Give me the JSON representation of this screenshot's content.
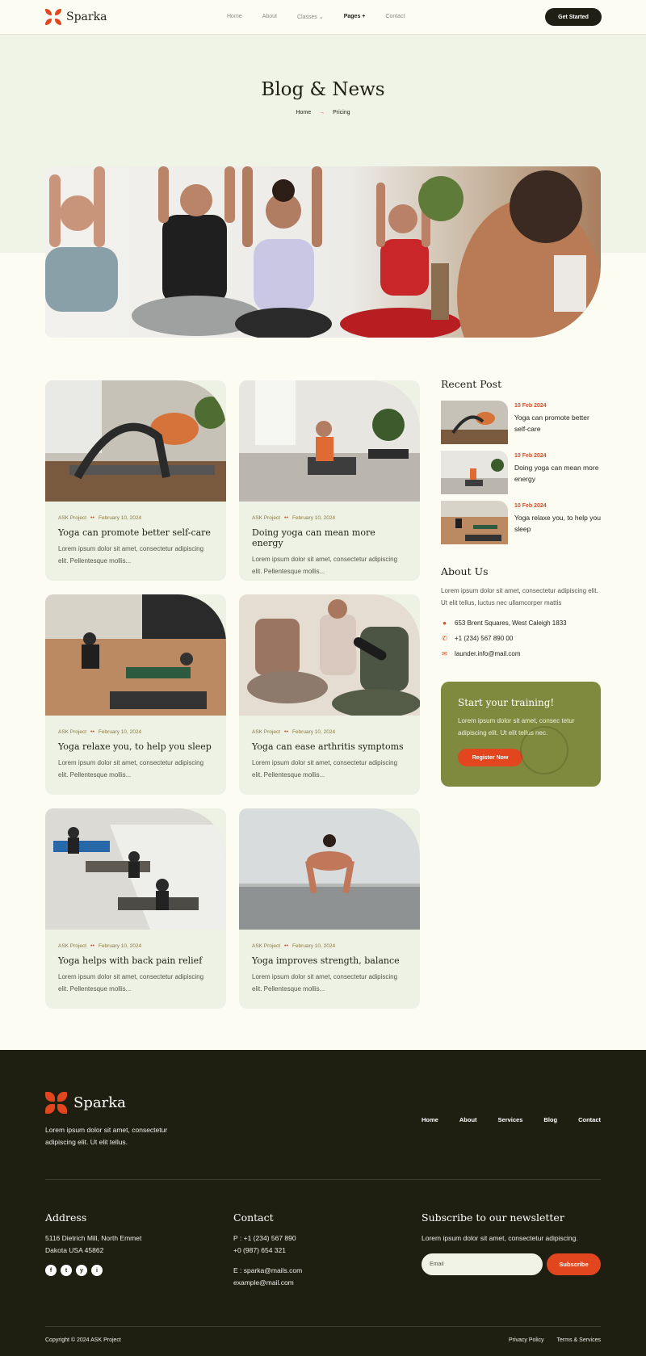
{
  "brand": {
    "name": "Sparka",
    "accent": "#e1461e",
    "dark": "#1f1f11",
    "olive": "#7f8a3f"
  },
  "nav": {
    "items": [
      "Home",
      "About",
      "Classes",
      "Pages",
      "Contact"
    ],
    "cta": "Get Started"
  },
  "hero": {
    "title": "Blog & News",
    "crumb_home": "Home",
    "crumb_current": "Pricing"
  },
  "posts": [
    {
      "category": "ASK Project",
      "date": "February 10, 2024",
      "title": "Yoga can promote better self-care",
      "excerpt": "Lorem ipsum dolor sit amet, consectetur adipiscing elit. Pellentesque mollis..."
    },
    {
      "category": "ASK Project",
      "date": "February 10, 2024",
      "title": "Doing yoga can mean more energy",
      "excerpt": "Lorem ipsum dolor sit amet, consectetur adipiscing elit. Pellentesque mollis..."
    },
    {
      "category": "ASK Project",
      "date": "February 10, 2024",
      "title": "Yoga relaxe you, to help you sleep",
      "excerpt": "Lorem ipsum dolor sit amet, consectetur adipiscing elit. Pellentesque mollis..."
    },
    {
      "category": "ASK Project",
      "date": "February 10, 2024",
      "title": "Yoga can ease arthritis symptoms",
      "excerpt": "Lorem ipsum dolor sit amet, consectetur adipiscing elit. Pellentesque mollis..."
    },
    {
      "category": "ASK Project",
      "date": "February 10, 2024",
      "title": "Yoga helps with back pain relief",
      "excerpt": "Lorem ipsum dolor sit amet, consectetur adipiscing elit. Pellentesque mollis..."
    },
    {
      "category": "ASK Project",
      "date": "February 10, 2024",
      "title": "Yoga improves strength, balance",
      "excerpt": "Lorem ipsum dolor sit amet, consectetur adipiscing elit. Pellentesque mollis..."
    }
  ],
  "sidebar": {
    "recent_title": "Recent Post",
    "recent": [
      {
        "date": "10 Feb 2024",
        "title": "Yoga can promote better self-care"
      },
      {
        "date": "10 Feb 2024",
        "title": "Doing yoga can mean more energy"
      },
      {
        "date": "10 Feb 2024",
        "title": "Yoga relaxe you, to help you sleep"
      }
    ],
    "about_title": "About Us",
    "about_text": "Lorem ipsum dolor sit amet, consectetur adipiscing elit. Ut elit tellus, luctus nec ullamcorper mattis",
    "address": "653 Brent Squares, West Caleigh 1833",
    "phone": "+1 (234) 567 890 00",
    "email": "launder.info@mail.com",
    "promo_title": "Start your training!",
    "promo_text": "Lorem ipsum dolor sit amet, consec tetur adipiscing elit. Ut elit tellus nec.",
    "promo_button": "Register Now"
  },
  "footer": {
    "about": "Lorem ipsum dolor sit amet, consectetur adipiscing elit. Ut elit tellus.",
    "nav": [
      "Home",
      "About",
      "Services",
      "Blog",
      "Contact"
    ],
    "address_title": "Address",
    "address_text": "5116 Dietrich Mill, North Emmet Dakota USA 45862",
    "contact_title": "Contact",
    "contact_phone1": "P : +1 (234) 567 890",
    "contact_phone2": "+0 (987) 654 321",
    "contact_email1": "E : sparka@mails.com",
    "contact_email2": "example@mail.com",
    "news_title": "Subscribe to our newsletter",
    "news_text": "Lorem ipsum dolor sit amet, consectetur adipiscing.",
    "email_placeholder": "Email",
    "subscribe": "Subscribe",
    "copyright": "Copyright © 2024 ASK Project",
    "privacy": "Privacy Policy",
    "terms": "Terms & Services",
    "socials": [
      "f",
      "t",
      "y",
      "i"
    ]
  }
}
